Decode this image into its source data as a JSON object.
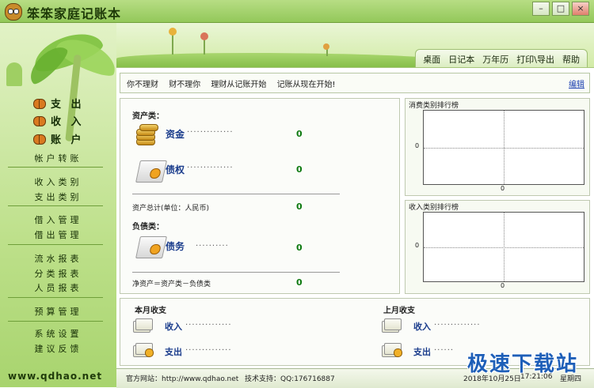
{
  "window": {
    "title": "笨笨家庭记账本",
    "minimize": "–",
    "maximize": "□",
    "close": "×"
  },
  "sidebar": {
    "main_items": [
      "支 出",
      "收 入",
      "账 户"
    ],
    "items": [
      "帐户转账",
      "收入类别",
      "支出类别",
      "借入管理",
      "借出管理",
      "流水报表",
      "分类报表",
      "人员报表",
      "预算管理",
      "系统设置",
      "建议反馈"
    ],
    "website": "www.qdhao.net"
  },
  "menu": {
    "tabs": [
      "桌面",
      "日记本",
      "万年历",
      "打印\\导出",
      "帮助"
    ]
  },
  "toolbar": {
    "slogans": [
      "你不理财",
      "财不理你",
      "理财从记账开始",
      "记账从现在开始!"
    ],
    "edit": "编辑"
  },
  "assets": {
    "section_label": "资产类：",
    "funds": {
      "label": "资金",
      "value": "0"
    },
    "credit": {
      "label": "债权",
      "value": "0"
    },
    "total_label": "资产总计(单位：人民币)",
    "total_value": "0",
    "liability_label": "负债类：",
    "debt": {
      "label": "债务",
      "value": "0"
    },
    "net_label": "净资产＝资产类－负债类",
    "net_value": "0"
  },
  "charts": {
    "expense": {
      "title": "消费类别排行榜",
      "y_tick": "0",
      "x_tick": "0"
    },
    "income": {
      "title": "收入类别排行榜",
      "y_tick": "0",
      "x_tick": "0"
    }
  },
  "chart_data": [
    {
      "type": "bar",
      "title": "消费类别排行榜",
      "categories": [],
      "values": [],
      "xlabel": "",
      "ylabel": "",
      "x_ticks": [
        "0"
      ],
      "y_ticks": [
        "0"
      ],
      "grid": true
    },
    {
      "type": "bar",
      "title": "收入类别排行榜",
      "categories": [],
      "values": [],
      "xlabel": "",
      "ylabel": "",
      "x_ticks": [
        "0"
      ],
      "y_ticks": [
        "0"
      ],
      "grid": true
    }
  ],
  "month": {
    "this_title": "本月收支",
    "last_title": "上月收支",
    "income_label": "收入",
    "expense_label": "支出"
  },
  "status": {
    "site_label": "官方网站：http://www.qdhao.net",
    "support_label": "技术支持：QQ:176716887",
    "date": "2018年10月25日",
    "time": "17:21:06",
    "weekday": "星期四"
  },
  "watermark": "极速下载站"
}
